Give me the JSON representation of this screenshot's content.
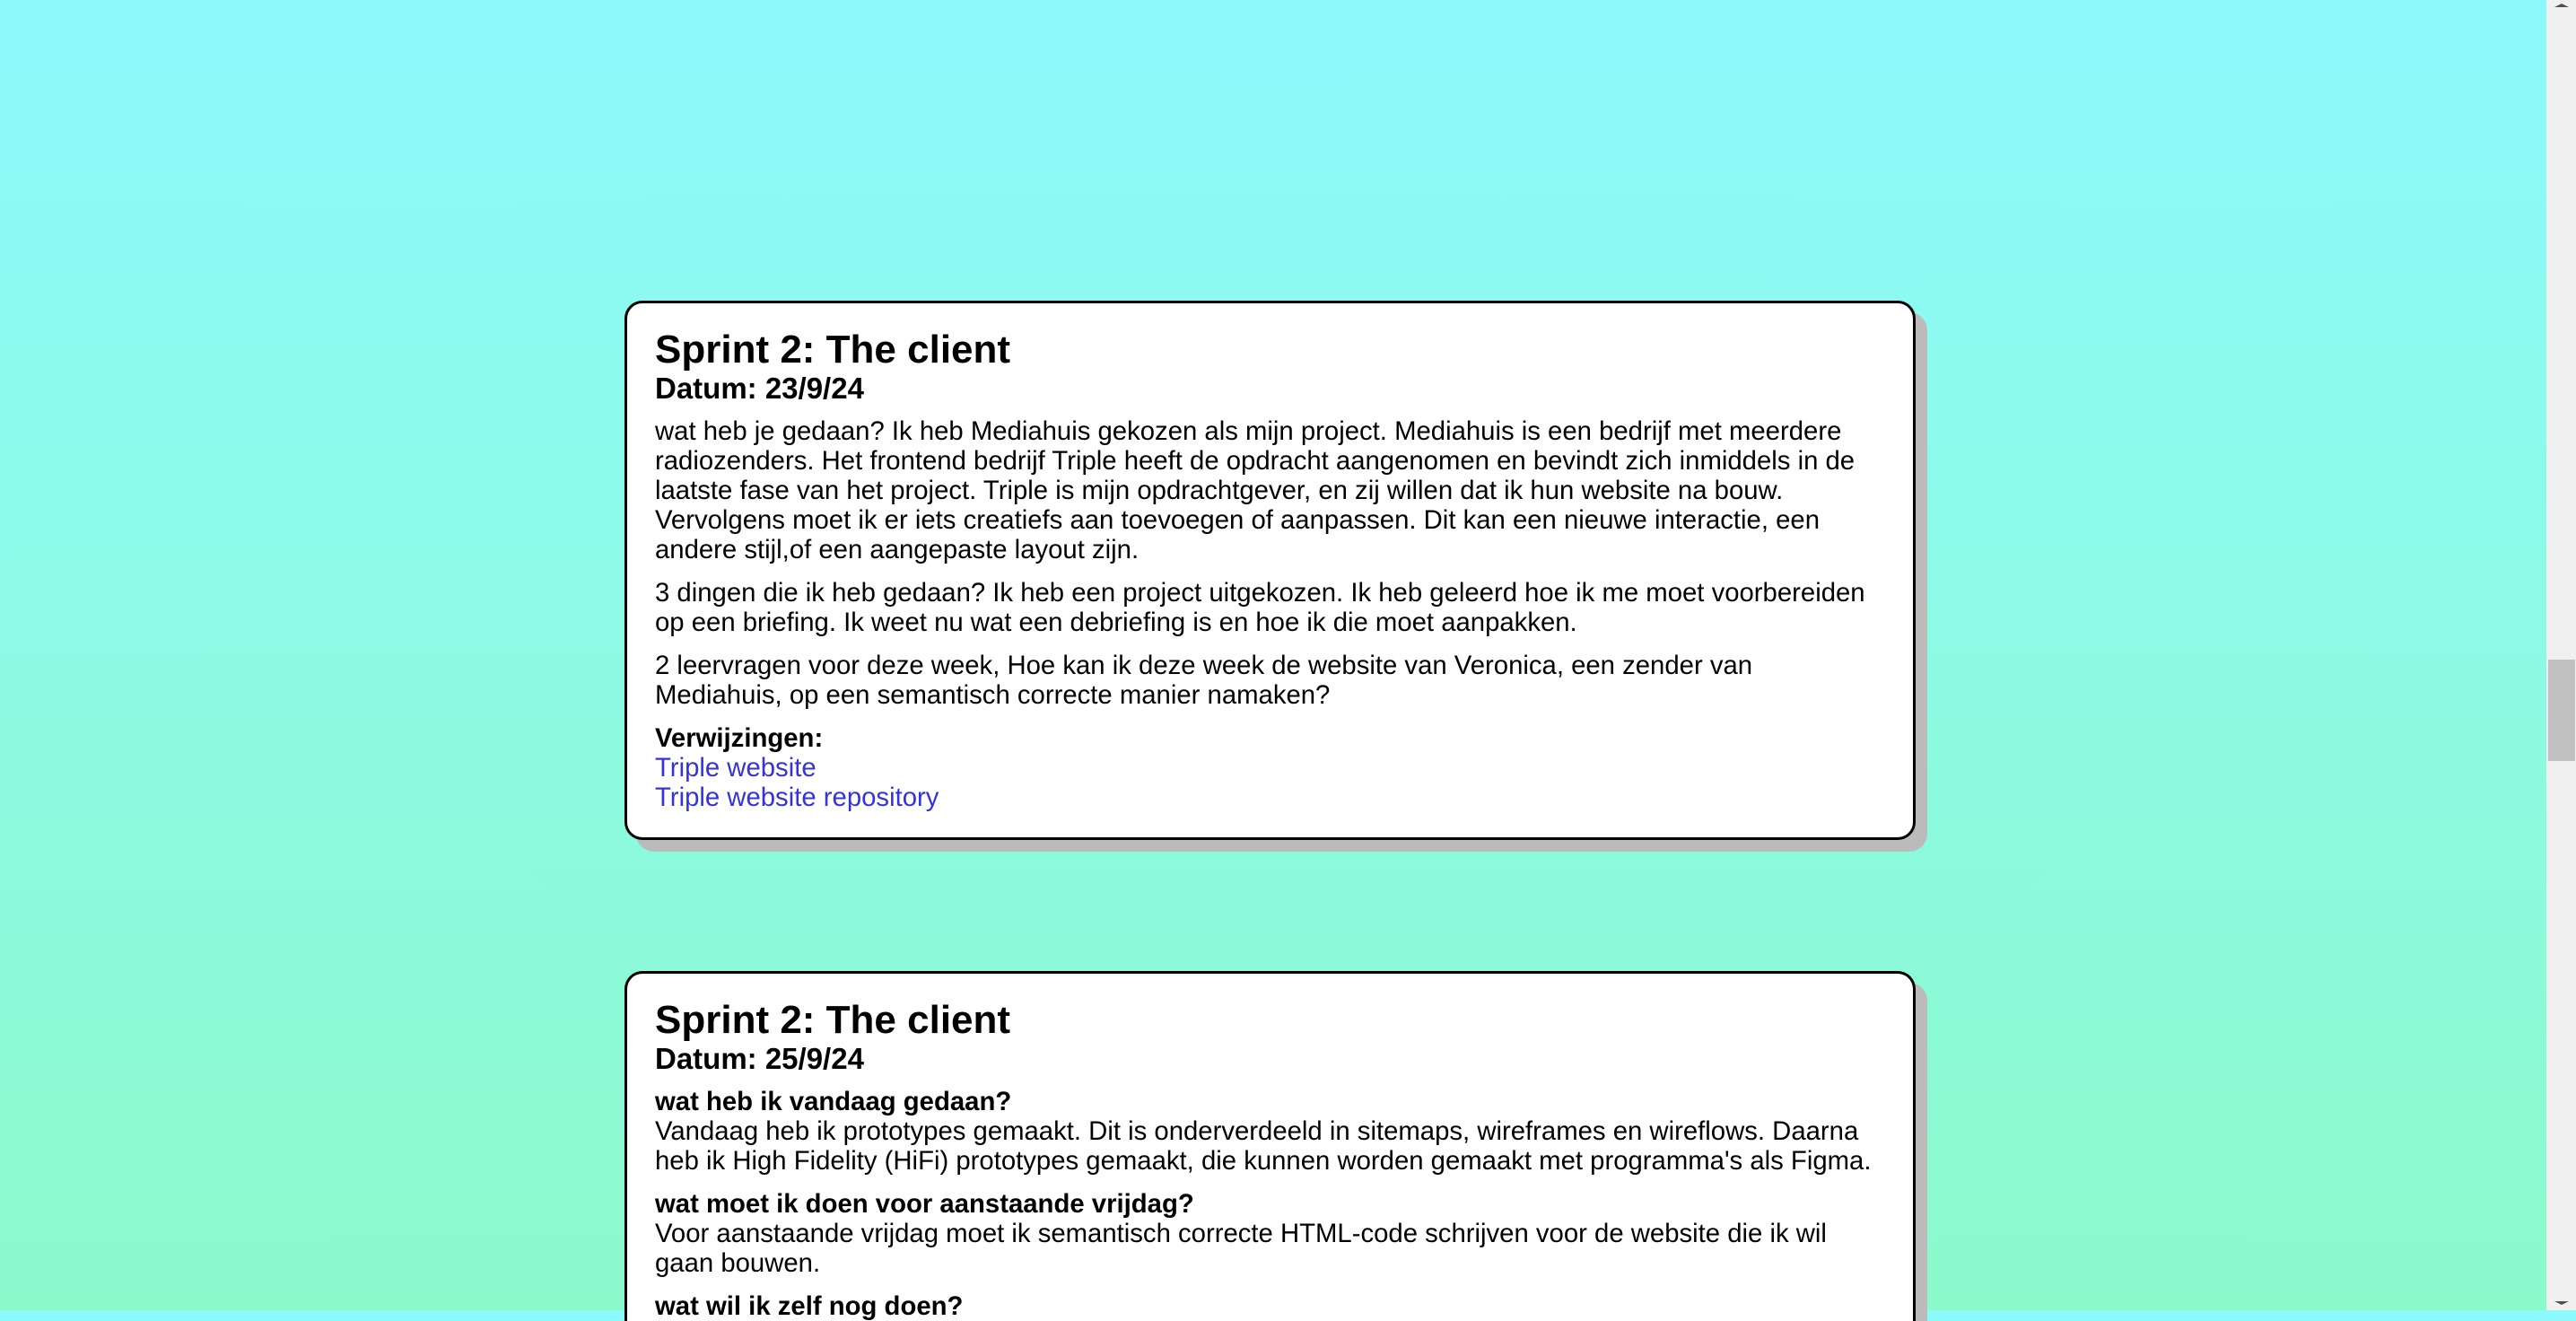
{
  "entries": [
    {
      "title": "Sprint 2: The client",
      "date": "Datum: 23/9/24",
      "paragraphs": [
        "wat heb je gedaan? Ik heb Mediahuis gekozen als mijn project. Mediahuis is een bedrijf met meerdere radiozenders. Het frontend bedrijf Triple heeft de opdracht aangenomen en bevindt zich inmiddels in de laatste fase van het project. Triple is mijn opdrachtgever, en zij willen dat ik hun website na bouw. Vervolgens moet ik er iets creatiefs aan toevoegen of aanpassen. Dit kan een nieuwe interactie, een andere stijl,of een aangepaste layout zijn.",
        "3 dingen die ik heb gedaan? Ik heb een project uitgekozen. Ik heb geleerd hoe ik me moet voorbereiden op een briefing. Ik weet nu wat een debriefing is en hoe ik die moet aanpakken.",
        "2 leervragen voor deze week, Hoe kan ik deze week de website van Veronica, een zender van Mediahuis, op een semantisch correcte manier namaken?"
      ],
      "refs_label": "Verwijzingen:",
      "links": [
        "Triple website",
        "Triple website repository"
      ]
    },
    {
      "title": "Sprint 2: The client",
      "date": "Datum: 25/9/24",
      "sections": [
        {
          "heading": "wat heb ik vandaag gedaan?",
          "text": "Vandaag heb ik prototypes gemaakt. Dit is onderverdeeld in sitemaps, wireframes en wireflows. Daarna heb ik High Fidelity (HiFi) prototypes gemaakt, die kunnen worden gemaakt met programma's als Figma."
        },
        {
          "heading": "wat moet ik doen voor aanstaande vrijdag?",
          "text": "Voor aanstaande vrijdag moet ik semantisch correcte HTML-code schrijven voor de website die ik wil gaan bouwen."
        },
        {
          "heading": "wat wil ik zelf nog doen?"
        }
      ]
    }
  ],
  "colors": {
    "link": "#3333dd",
    "background_top": "#8cfafc",
    "background_bottom": "#8cf9cb"
  }
}
